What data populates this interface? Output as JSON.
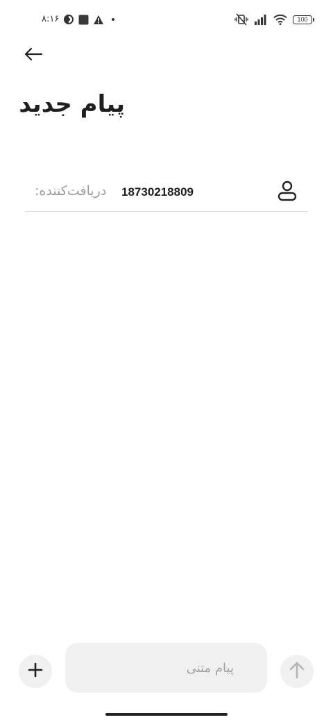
{
  "status_bar": {
    "time": "۸:۱۶",
    "left_icons": [
      "data-saver-icon",
      "notification-square-icon",
      "warning-icon",
      "dot-icon"
    ],
    "right_icons": [
      "vibrate-off-icon",
      "signal-icon",
      "wifi-icon"
    ],
    "battery_level": "100"
  },
  "header": {
    "back_icon": "back-arrow-icon",
    "title": "پیام جدید"
  },
  "recipient": {
    "label": "دریافت‌کننده:",
    "value": "18730218809",
    "contact_icon": "person-icon"
  },
  "composer": {
    "add_icon": "plus-icon",
    "placeholder": "پیام متنی",
    "send_icon": "arrow-up-icon"
  },
  "colors": {
    "background": "#ffffff",
    "text": "#1f1f1f",
    "muted": "#9a9a9a",
    "pill": "#f0f0f0"
  }
}
